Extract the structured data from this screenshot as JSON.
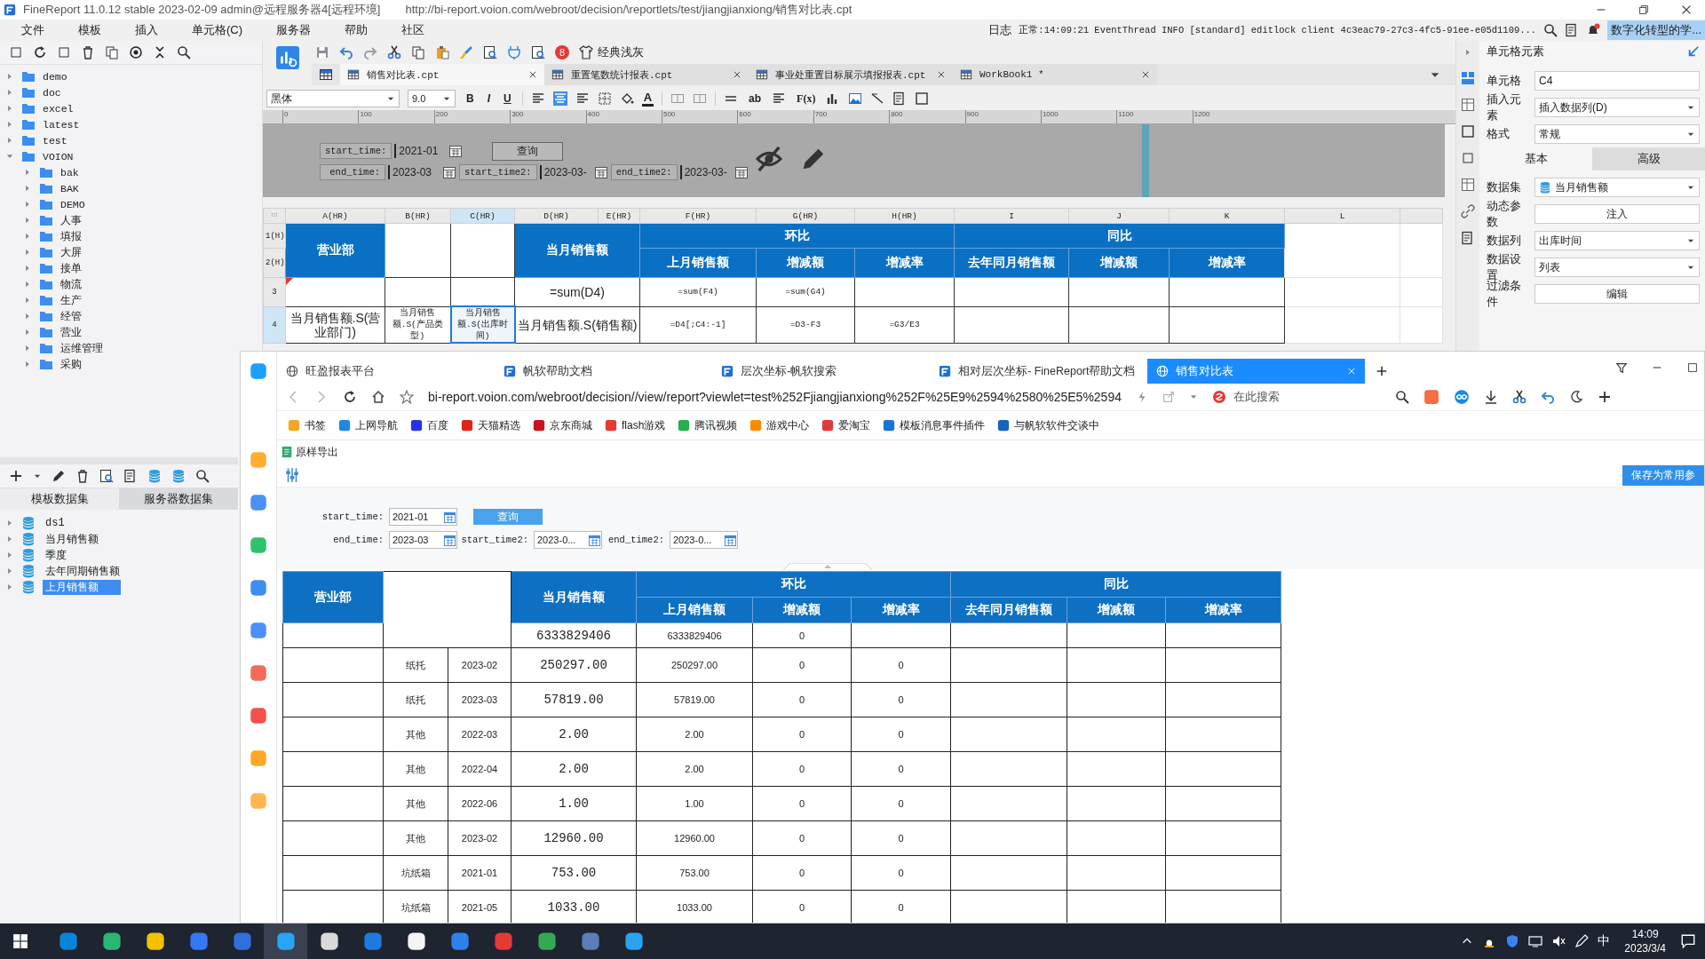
{
  "title_bar": {
    "title": "FineReport 11.0.12 stable 2023-02-09 admin@远程服务器4[远程环境]",
    "path": "http://bi-report.voion.com/webroot/decision/\\reportlets/test/jiangjianxiong/销售对比表.cpt"
  },
  "menu": [
    "文件",
    "模板",
    "插入",
    "单元格(C)",
    "服务器",
    "帮助",
    "社区"
  ],
  "log": {
    "label": "日志",
    "message": "正常:14:09:21 EventThread INFO [standard] editlock client 4c3eac79-27c3-4fc5-91ee-e05d1109...",
    "notice": "数字化转型的学..."
  },
  "file_tree": [
    {
      "name": "demo",
      "expanded": false
    },
    {
      "name": "doc",
      "expanded": false
    },
    {
      "name": "excel",
      "expanded": false
    },
    {
      "name": "latest",
      "expanded": false
    },
    {
      "name": "test",
      "expanded": false
    },
    {
      "name": "VOION",
      "expanded": true,
      "children": [
        {
          "name": "bak",
          "expanded": false
        },
        {
          "name": "BAK",
          "expanded": false
        },
        {
          "name": "DEMO",
          "expanded": false
        },
        {
          "name": "人事",
          "expanded": false
        },
        {
          "name": "填报",
          "expanded": false
        },
        {
          "name": "大屏",
          "expanded": false
        },
        {
          "name": "接单",
          "expanded": false
        },
        {
          "name": "物流",
          "expanded": false
        },
        {
          "name": "生产",
          "expanded": false
        },
        {
          "name": "经管",
          "expanded": false
        },
        {
          "name": "营业",
          "expanded": false
        },
        {
          "name": "运维管理",
          "expanded": false
        },
        {
          "name": "采购",
          "expanded": false
        }
      ]
    }
  ],
  "dataset_tabs": [
    {
      "label": "模板数据集",
      "selected": true
    },
    {
      "label": "服务器数据集",
      "selected": false
    }
  ],
  "datasets": [
    {
      "name": "ds1",
      "selected": false
    },
    {
      "name": "当月销售额",
      "selected": false
    },
    {
      "name": "季度",
      "selected": false
    },
    {
      "name": "去年同期销售额",
      "selected": false
    },
    {
      "name": "上月销售额",
      "selected": true
    }
  ],
  "designer": {
    "theme": {
      "badge": "8",
      "label": "经典浅灰"
    },
    "tabs": [
      {
        "label": "销售对比表.cpt",
        "selected": true
      },
      {
        "label": "重置笔数统计报表.cpt",
        "selected": false
      },
      {
        "label": "事业处重置目标展示填报报表.cpt",
        "selected": false
      },
      {
        "label": "WorkBook1 *",
        "selected": false
      }
    ],
    "format": {
      "font": "黑体",
      "size": "9.0",
      "style_buttons": [
        "B",
        "I",
        "U"
      ],
      "color_glyph": "A",
      "wrap_glyph": "ab",
      "formula_glyph": "F(x)"
    },
    "ruler": [
      "0",
      "100",
      "200",
      "300",
      "400",
      "500",
      "600",
      "700",
      "800",
      "900",
      "1000",
      "1100",
      "1200"
    ],
    "params": [
      [
        {
          "label": "start_time:",
          "value": "2021-01"
        }
      ],
      [
        {
          "label": "end_time:",
          "value": "2023-03"
        },
        {
          "label": "start_time2:",
          "value": "2023-03-"
        },
        {
          "label": "end_time2:",
          "value": "2023-03-"
        }
      ]
    ],
    "query": "查询",
    "grid": {
      "columns": [
        {
          "label": "A(HR)",
          "selected": false
        },
        {
          "label": "B(HR)",
          "selected": false
        },
        {
          "label": "C(HR)",
          "selected": true
        },
        {
          "label": "D(HR)",
          "selected": false
        },
        {
          "label": "E(HR)",
          "selected": false
        },
        {
          "label": "F(HR)",
          "selected": false
        },
        {
          "label": "G(HR)",
          "selected": false
        },
        {
          "label": "H(HR)",
          "selected": false
        },
        {
          "label": "I",
          "selected": false
        },
        {
          "label": "J",
          "selected": false
        },
        {
          "label": "K",
          "selected": false
        },
        {
          "label": "L",
          "selected": false
        }
      ],
      "row_labels": [
        {
          "label": "1(H)",
          "selected": false
        },
        {
          "label": "2(H)",
          "selected": false
        },
        {
          "label": "3",
          "selected": false
        },
        {
          "label": "4",
          "selected": true
        }
      ],
      "header": {
        "dept": "营业部",
        "sales": "当月销售额",
        "mom": "环比",
        "yoy": "同比",
        "sub": [
          "上月销售额",
          "增减额",
          "增减率",
          "去年同月销售额",
          "增减额",
          "增减率"
        ]
      },
      "total_row": {
        "flagged": true,
        "sales": "=sum(D4)",
        "prev": "=sum(F4)",
        "diff": "=sum(G4)"
      },
      "detail_row": [
        {
          "text": "当月销售额.S(营业部门)",
          "selected": false
        },
        {
          "text": "当月销售额.S(产品类型)",
          "selected": false
        },
        {
          "text": "当月销售额.S(出库时间)",
          "selected": true
        },
        {
          "text": "当月销售额.S(销售额)",
          "selected": false
        },
        {
          "text": "=D4[;C4:-1]",
          "selected": false
        },
        {
          "text": "=D3-F3",
          "selected": false
        },
        {
          "text": "=G3/E3",
          "selected": false
        }
      ]
    }
  },
  "properties": {
    "title": "单元格元素",
    "top": [
      {
        "kind": "input",
        "label": "单元格",
        "value": "C4"
      },
      {
        "kind": "select",
        "label": "插入元素",
        "value": "插入数据列(D)"
      },
      {
        "kind": "select",
        "label": "格式",
        "value": "常规"
      }
    ],
    "tabs": [
      {
        "label": "基本",
        "selected": true
      },
      {
        "label": "高级",
        "selected": false
      }
    ],
    "bottom": [
      {
        "kind": "dataset",
        "label": "数据集",
        "value": "当月销售额"
      },
      {
        "kind": "button",
        "label": "动态参数",
        "value": "注入"
      },
      {
        "kind": "select",
        "label": "数据列",
        "value": "出库时间"
      },
      {
        "kind": "select",
        "label": "数据设置",
        "value": "列表"
      },
      {
        "kind": "button",
        "label": "过滤条件",
        "value": "编辑"
      }
    ]
  },
  "browser": {
    "side_apps": [
      {
        "color": "#1aa0ff"
      },
      {
        "color": "#ffad33"
      },
      {
        "color": "#4a90f7"
      },
      {
        "color": "#2dc26b"
      },
      {
        "color": "#3d8ef0"
      },
      {
        "color": "#4a90f7"
      },
      {
        "color": "#f26a5a"
      },
      {
        "color": "#f2524a"
      },
      {
        "color": "#ffa726"
      },
      {
        "color": "#ffb74d"
      }
    ],
    "tabs": [
      {
        "kind": "globe",
        "label": "旺盈报表平台",
        "selected": false
      },
      {
        "kind": "app",
        "label": "帆软帮助文档",
        "selected": false
      },
      {
        "kind": "app",
        "label": "层次坐标-帆软搜索",
        "selected": false
      },
      {
        "kind": "app",
        "label": "相对层次坐标- FineReport帮助文档",
        "selected": false
      },
      {
        "kind": "globe",
        "label": "销售对比表",
        "selected": true
      }
    ],
    "url": "bi-report.voion.com/webroot/decision//view/report?viewlet=test%252Fjiangjianxiong%252F%25E9%2594%2580%25E5%2594",
    "search_placeholder": "在此搜索",
    "bookmarks": [
      {
        "label": "书签",
        "color": "#f5a623"
      },
      {
        "label": "上网导航",
        "color": "#1e88e5"
      },
      {
        "label": "百度",
        "color": "#2932e1"
      },
      {
        "label": "天猫精选",
        "color": "#e2231a"
      },
      {
        "label": "京东商城",
        "color": "#c9151e"
      },
      {
        "label": "flash游戏",
        "color": "#e53935"
      },
      {
        "label": "腾讯视频",
        "color": "#22b14c"
      },
      {
        "label": "游戏中心",
        "color": "#ff8a00"
      },
      {
        "label": "爱淘宝",
        "color": "#e4393c"
      },
      {
        "label": "模板消息事件插件",
        "color": "#1976d2"
      },
      {
        "label": "与帆软软件交谈中",
        "color": "#1565c0"
      }
    ],
    "export": "原样导出",
    "save_params": "保存为常用参",
    "params": [
      [
        {
          "label": "start_time:",
          "value": "2021-01"
        }
      ],
      [
        {
          "label": "end_time:",
          "value": "2023-03"
        },
        {
          "label": "start_time2:",
          "value": "2023-0..."
        },
        {
          "label": "end_time2:",
          "value": "2023-0..."
        }
      ]
    ],
    "query": "查询",
    "table": {
      "header": {
        "dept": "营业部",
        "sales": "当月销售额",
        "mom": "环比",
        "yoy": "同比",
        "sub": [
          "上月销售额",
          "增减额",
          "增减率",
          "去年同月销售额",
          "增减额",
          "增减率"
        ]
      },
      "total": {
        "sales": "6333829406",
        "prev": "6333829406",
        "diff": "0"
      },
      "rows": [
        {
          "product": "纸托",
          "month": "2023-02",
          "sales": "250297.00",
          "prev": "250297.00",
          "diff": "0",
          "rate": "0"
        },
        {
          "product": "纸托",
          "month": "2023-03",
          "sales": "57819.00",
          "prev": "57819.00",
          "diff": "0",
          "rate": "0"
        },
        {
          "product": "其他",
          "month": "2022-03",
          "sales": "2.00",
          "prev": "2.00",
          "diff": "0",
          "rate": "0"
        },
        {
          "product": "其他",
          "month": "2022-04",
          "sales": "2.00",
          "prev": "2.00",
          "diff": "0",
          "rate": "0"
        },
        {
          "product": "其他",
          "month": "2022-06",
          "sales": "1.00",
          "prev": "1.00",
          "diff": "0",
          "rate": "0"
        },
        {
          "product": "其他",
          "month": "2023-02",
          "sales": "12960.00",
          "prev": "12960.00",
          "diff": "0",
          "rate": "0"
        },
        {
          "product": "坑纸箱",
          "month": "2021-01",
          "sales": "753.00",
          "prev": "753.00",
          "diff": "0",
          "rate": "0"
        },
        {
          "product": "坑纸箱",
          "month": "2021-05",
          "sales": "1033.00",
          "prev": "1033.00",
          "diff": "0",
          "rate": "0"
        }
      ]
    }
  },
  "taskbar": {
    "apps": [
      {
        "color": "#0a84d8",
        "selected": false
      },
      {
        "color": "#2bb673",
        "selected": false
      },
      {
        "color": "#f2c200",
        "selected": false
      },
      {
        "color": "#3478f6",
        "selected": false
      },
      {
        "color": "#2f6fde",
        "selected": false
      },
      {
        "color": "#2aa4f4",
        "selected": true
      },
      {
        "color": "#d9d9d9",
        "selected": false
      },
      {
        "color": "#1f7ae0",
        "selected": false
      },
      {
        "color": "#f5f5f5",
        "selected": false
      },
      {
        "color": "#2f80ed",
        "selected": false
      },
      {
        "color": "#e53935",
        "selected": false
      },
      {
        "color": "#34a853",
        "selected": false
      },
      {
        "color": "#5b7db8",
        "selected": false
      },
      {
        "color": "#29a3f0",
        "selected": false
      }
    ],
    "ime": "中",
    "time": "14:09",
    "date": "2023/3/4"
  }
}
